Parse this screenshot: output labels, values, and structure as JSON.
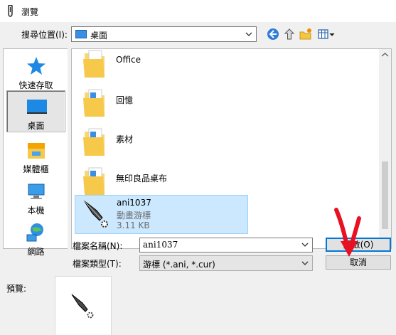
{
  "window": {
    "title": "瀏覽"
  },
  "look_in": {
    "label": "搜尋位置(I):",
    "value": "桌面"
  },
  "toolbar": {
    "back_icon": "back-arrow-icon",
    "up_icon": "up-folder-icon",
    "newfolder_icon": "new-folder-icon",
    "view_icon": "view-menu-icon"
  },
  "places": [
    {
      "label": "快速存取",
      "icon": "star-icon"
    },
    {
      "label": "桌面",
      "icon": "desktop-icon"
    },
    {
      "label": "媒體櫃",
      "icon": "libraries-icon"
    },
    {
      "label": "本機",
      "icon": "computer-icon"
    },
    {
      "label": "網路",
      "icon": "network-icon"
    }
  ],
  "files": [
    {
      "name": "Office",
      "type": "folder"
    },
    {
      "name": "回憶",
      "type": "folder"
    },
    {
      "name": "素材",
      "type": "folder"
    },
    {
      "name": "無印良品桌布",
      "type": "folder"
    },
    {
      "name": "ani1037",
      "type": "cursor",
      "kind": "動畫游標",
      "size": "3.11 KB"
    }
  ],
  "filename": {
    "label": "檔案名稱(N):",
    "value": "ani1037"
  },
  "filetype": {
    "label": "檔案類型(T):",
    "value": "游標 (*.ani, *.cur)"
  },
  "buttons": {
    "open": "開啟(O)",
    "cancel": "取消"
  },
  "preview": {
    "label": "預覽:"
  },
  "colors": {
    "accent": "#0078d7",
    "selection": "#cce8ff",
    "annotation_arrow": "#e81123"
  }
}
